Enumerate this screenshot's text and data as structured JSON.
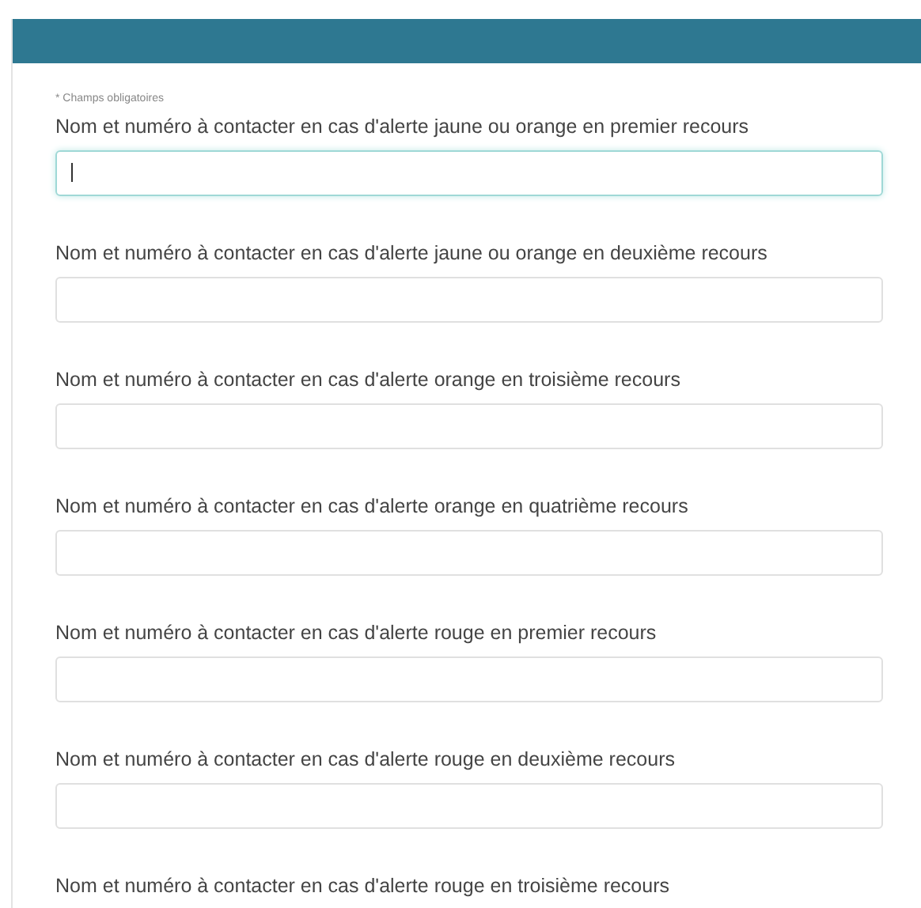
{
  "required_note": "* Champs obligatoires",
  "fields": [
    {
      "label": "Nom et numéro à contacter en cas d'alerte jaune ou orange en premier recours",
      "focused": true
    },
    {
      "label": "Nom et numéro à contacter en cas d'alerte jaune ou orange en deuxième recours",
      "focused": false
    },
    {
      "label": "Nom et numéro à contacter en cas d'alerte orange en troisième recours",
      "focused": false
    },
    {
      "label": "Nom et numéro à contacter en cas d'alerte orange en quatrième recours",
      "focused": false
    },
    {
      "label": "Nom et numéro à contacter en cas d'alerte rouge en premier recours",
      "focused": false
    },
    {
      "label": "Nom et numéro à contacter en cas d'alerte rouge en deuxième recours",
      "focused": false
    },
    {
      "label": "Nom et numéro à contacter en cas d'alerte rouge en troisième recours"
    }
  ]
}
